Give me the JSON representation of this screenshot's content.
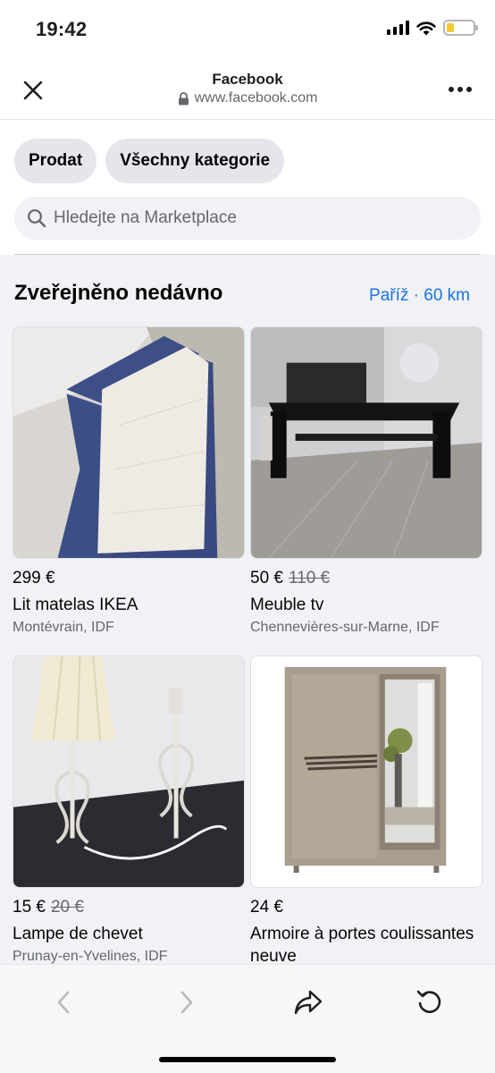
{
  "status_bar": {
    "time": "19:42"
  },
  "browser": {
    "title": "Facebook",
    "url": "www.facebook.com"
  },
  "chips": [
    {
      "label": "Prodat"
    },
    {
      "label": "Všechny kategorie"
    }
  ],
  "search": {
    "placeholder": "Hledejte na Marketplace"
  },
  "section": {
    "title": "Zveřejněno nedávno",
    "location": "Paříž · 60 km"
  },
  "listings": [
    {
      "price": "299 €",
      "old_price": "",
      "title": "Lit matelas IKEA",
      "location": "Montévrain, IDF"
    },
    {
      "price": "50 €",
      "old_price": "110 €",
      "title": "Meuble tv",
      "location": "Chennevières-sur-Marne, IDF"
    },
    {
      "price": "15 €",
      "old_price": "20 €",
      "title": "Lampe de chevet",
      "location": "Prunay-en-Yvelines, IDF"
    },
    {
      "price": "24 €",
      "old_price": "",
      "title": "Armoire à portes coulissantes neuve",
      "location": ""
    }
  ],
  "colors": {
    "accent": "#1b74e4",
    "chip_bg": "#e4e6eb",
    "section_bg": "#f0f2f5",
    "battery": "#f7c730"
  },
  "icons": {
    "close": "close-icon",
    "lock": "lock-icon",
    "more": "more-icon",
    "search": "search-icon",
    "back": "chevron-left-icon",
    "forward": "chevron-right-icon",
    "share": "share-icon",
    "reload": "reload-icon"
  }
}
